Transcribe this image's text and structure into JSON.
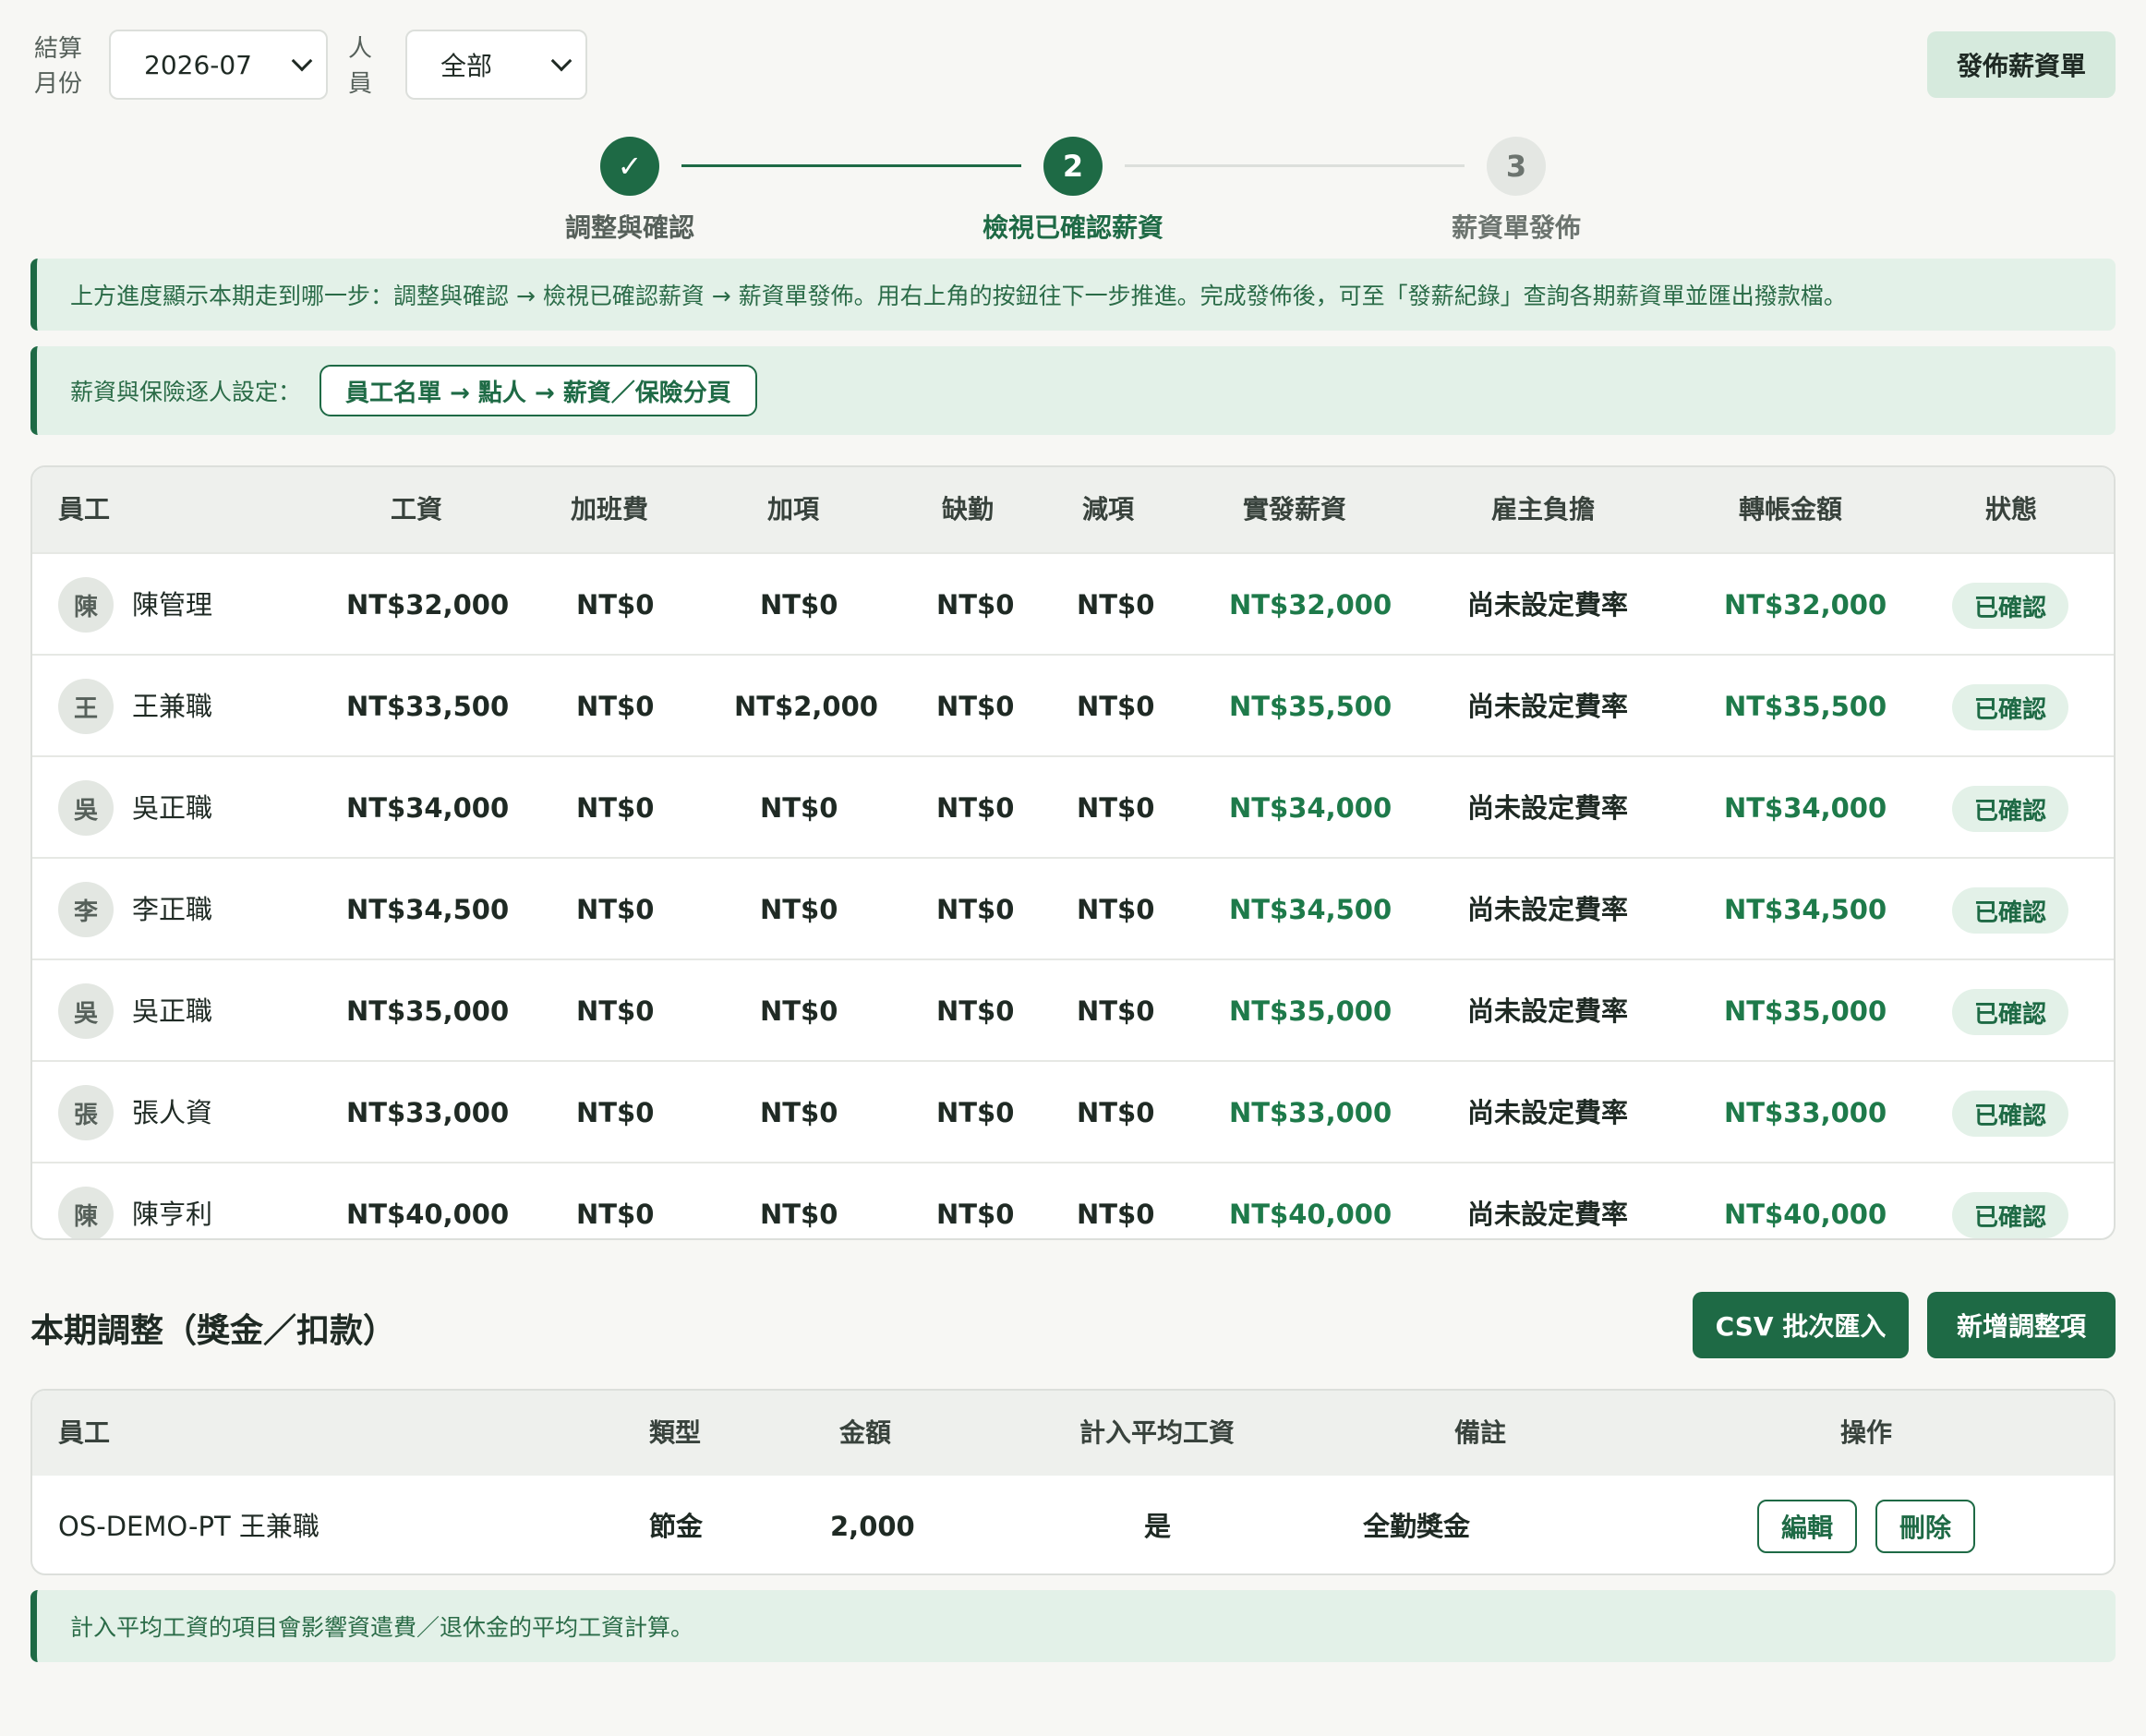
{
  "filters": {
    "month_label": "結算月份",
    "month_value": "2026-07",
    "person_label": "人員",
    "person_value": "全部"
  },
  "publish_button": "發佈薪資單",
  "stepper": [
    {
      "symbol": "✓",
      "label": "調整與確認",
      "state": "done"
    },
    {
      "symbol": "2",
      "label": "檢視已確認薪資",
      "state": "active"
    },
    {
      "symbol": "3",
      "label": "薪資單發佈",
      "state": "todo"
    }
  ],
  "progress_note": "上方進度顯示本期走到哪一步：調整與確認 → 檢視已確認薪資 → 薪資單發佈。用右上角的按鈕往下一步推進。完成發佈後，可至「發薪紀錄」查詢各期薪資單並匯出撥款檔。",
  "settings_note": {
    "label": "薪資與保險逐人設定：",
    "link": "員工名單 → 點人 → 薪資／保險分頁"
  },
  "payroll_table": {
    "headers": [
      "員工",
      "工資",
      "加班費",
      "加項",
      "缺勤",
      "減項",
      "實發薪資",
      "雇主負擔",
      "轉帳金額",
      "狀態"
    ],
    "rows": [
      {
        "initial": "陳",
        "name": "陳管理",
        "wage": "NT$32,000",
        "overtime": "NT$0",
        "additions": "NT$0",
        "absence": "NT$0",
        "deductions": "NT$0",
        "net_pay": "NT$32,000",
        "employer": "尚未設定費率",
        "transfer": "NT$32,000",
        "status": "已確認"
      },
      {
        "initial": "王",
        "name": "王兼職",
        "wage": "NT$33,500",
        "overtime": "NT$0",
        "additions": "NT$2,000",
        "absence": "NT$0",
        "deductions": "NT$0",
        "net_pay": "NT$35,500",
        "employer": "尚未設定費率",
        "transfer": "NT$35,500",
        "status": "已確認"
      },
      {
        "initial": "吳",
        "name": "吳正職",
        "wage": "NT$34,000",
        "overtime": "NT$0",
        "additions": "NT$0",
        "absence": "NT$0",
        "deductions": "NT$0",
        "net_pay": "NT$34,000",
        "employer": "尚未設定費率",
        "transfer": "NT$34,000",
        "status": "已確認"
      },
      {
        "initial": "李",
        "name": "李正職",
        "wage": "NT$34,500",
        "overtime": "NT$0",
        "additions": "NT$0",
        "absence": "NT$0",
        "deductions": "NT$0",
        "net_pay": "NT$34,500",
        "employer": "尚未設定費率",
        "transfer": "NT$34,500",
        "status": "已確認"
      },
      {
        "initial": "吳",
        "name": "吳正職",
        "wage": "NT$35,000",
        "overtime": "NT$0",
        "additions": "NT$0",
        "absence": "NT$0",
        "deductions": "NT$0",
        "net_pay": "NT$35,000",
        "employer": "尚未設定費率",
        "transfer": "NT$35,000",
        "status": "已確認"
      },
      {
        "initial": "張",
        "name": "張人資",
        "wage": "NT$33,000",
        "overtime": "NT$0",
        "additions": "NT$0",
        "absence": "NT$0",
        "deductions": "NT$0",
        "net_pay": "NT$33,000",
        "employer": "尚未設定費率",
        "transfer": "NT$33,000",
        "status": "已確認"
      },
      {
        "initial": "陳",
        "name": "陳亨利",
        "wage": "NT$40,000",
        "overtime": "NT$0",
        "additions": "NT$0",
        "absence": "NT$0",
        "deductions": "NT$0",
        "net_pay": "NT$40,000",
        "employer": "尚未設定費率",
        "transfer": "NT$40,000",
        "status": "已確認"
      }
    ]
  },
  "adjustments": {
    "title": "本期調整（獎金／扣款）",
    "csv_button": "CSV 批次匯入",
    "add_button": "新增調整項",
    "headers": [
      "員工",
      "類型",
      "金額",
      "計入平均工資",
      "備註",
      "操作"
    ],
    "rows": [
      {
        "employee": "OS-DEMO-PT 王兼職",
        "type": "節金",
        "amount": "2,000",
        "in_average": "是",
        "note": "全勤獎金",
        "edit": "編輯",
        "delete": "刪除"
      }
    ]
  },
  "footer_note": "計入平均工資的項目會影響資遣費／退休金的平均工資計算。",
  "colors": {
    "accent": "#1e6a45",
    "positive": "#1e7a4a",
    "banner": "#e3f1e8"
  }
}
